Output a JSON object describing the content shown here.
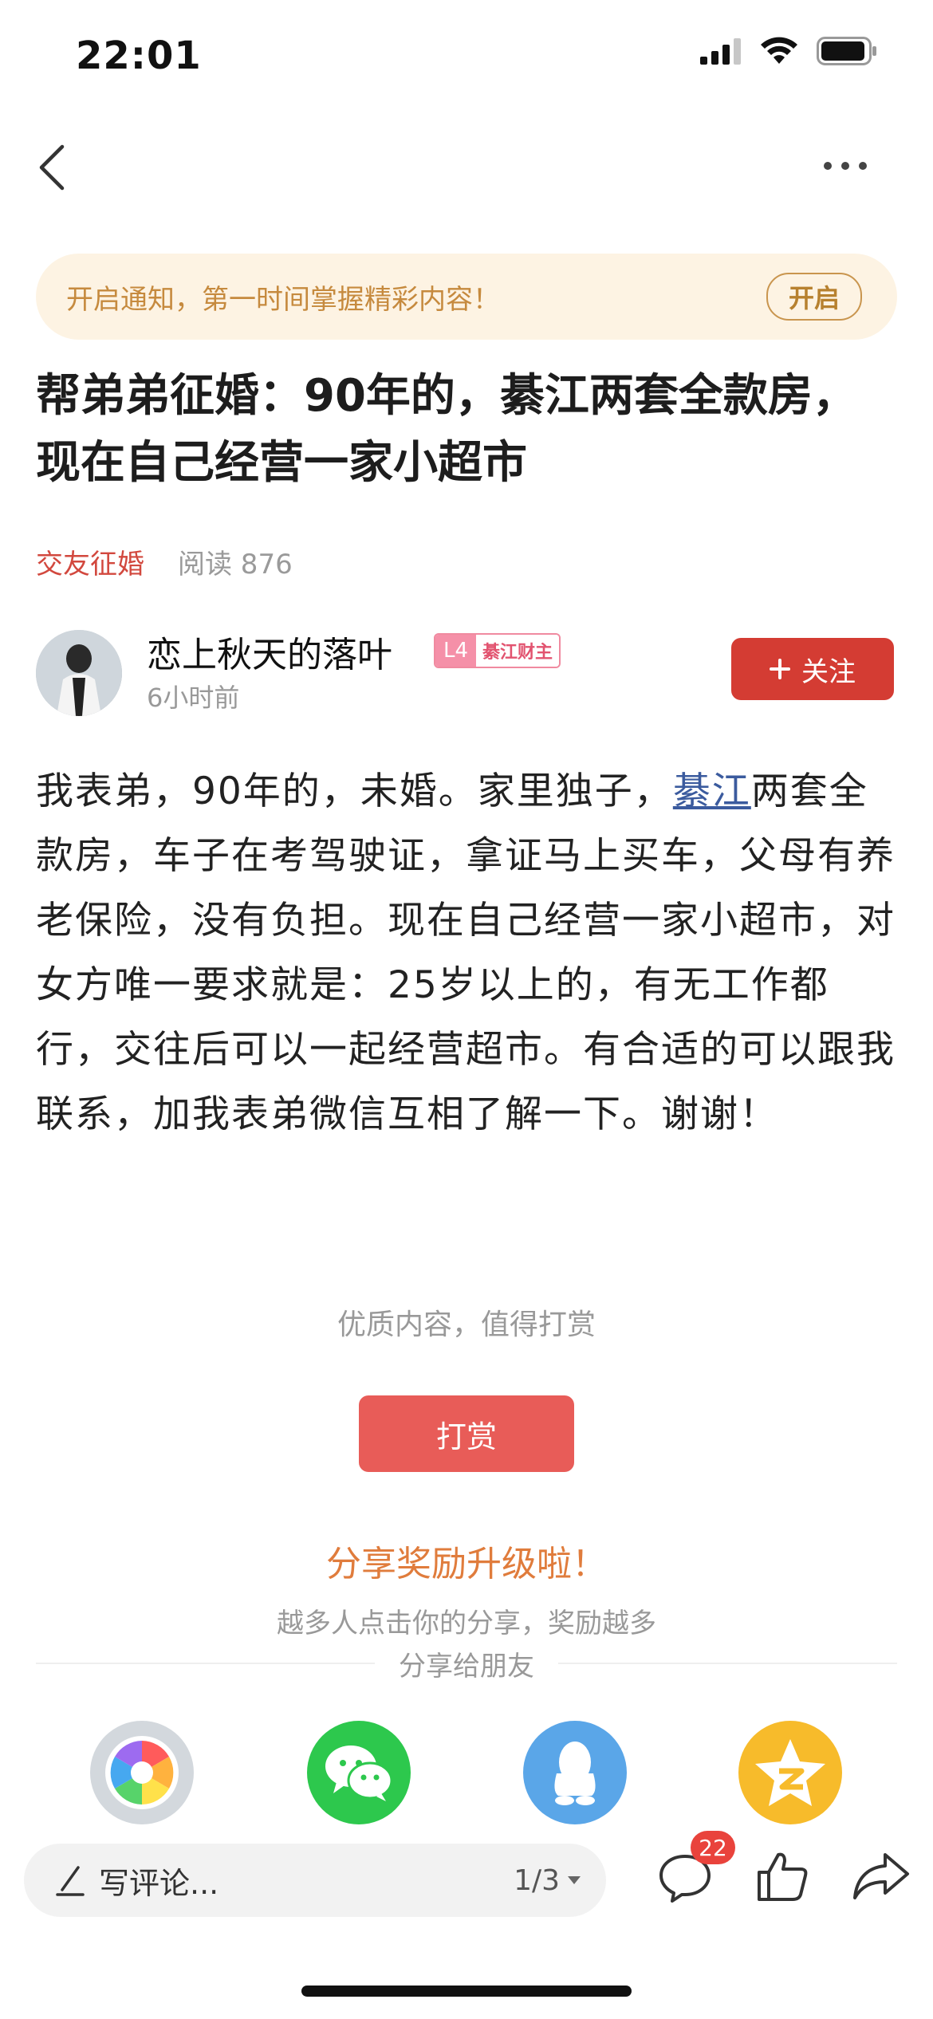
{
  "status_bar": {
    "time": "22:01"
  },
  "notice": {
    "text": "开启通知，第一时间掌握精彩内容！",
    "button": "开启"
  },
  "article": {
    "title": "帮弟弟征婚：90年的，綦江两套全款房，现在自己经营一家小超市",
    "category": "交友征婚",
    "reads": "阅读 876",
    "author": {
      "name": "恋上秋天的落叶",
      "level": "L4",
      "level_title": "綦江财主",
      "time": "6小时前",
      "follow_label": "关注"
    },
    "body_before_link": "我表弟，90年的，未婚。家里独子，",
    "body_link": "綦江",
    "body_after_link": "两套全款房，车子在考驾驶证，拿证马上买车，父母有养老保险，没有负担。现在自己经营一家小超市，对女方唯一要求就是：25岁以上的，有无工作都行，交往后可以一起经营超市。有合适的可以跟我联系，加我表弟微信互相了解一下。谢谢！"
  },
  "reward": {
    "hint": "优质内容，值得打赏",
    "button": "打赏"
  },
  "share": {
    "title": "分享奖励升级啦！",
    "subtitle": "越多人点击你的分享，奖励越多",
    "label": "分享给朋友",
    "targets": [
      {
        "icon": "camera-aperture-icon",
        "color": "#c9d1d8"
      },
      {
        "icon": "wechat-icon",
        "color": "#2dc84d"
      },
      {
        "icon": "qq-icon",
        "color": "#5aa6e8"
      },
      {
        "icon": "qzone-icon",
        "color": "#f7bb2b"
      }
    ]
  },
  "bottom_bar": {
    "comment_placeholder": "写评论...",
    "page_indicator": "1/3",
    "comment_count": "22"
  },
  "colors": {
    "accent_red": "#d43c33",
    "reward_red": "#e85c58",
    "share_orange": "#e07c3c",
    "link_blue": "#3b5b9e"
  }
}
